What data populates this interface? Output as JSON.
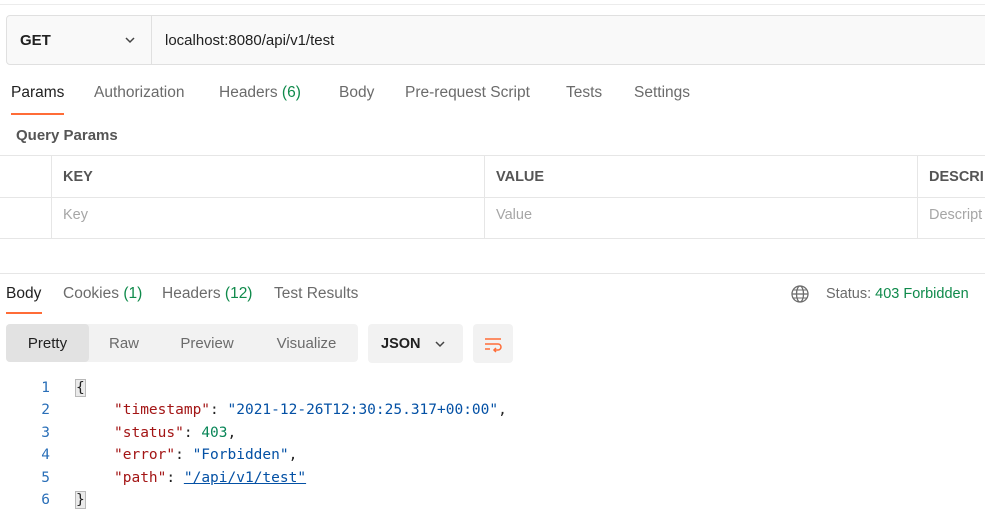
{
  "request": {
    "method": "GET",
    "url": "localhost:8080/api/v1/test"
  },
  "request_tabs": [
    {
      "label": "Params",
      "count": "",
      "active": true
    },
    {
      "label": "Authorization",
      "count": ""
    },
    {
      "label": "Headers",
      "count": "(6)"
    },
    {
      "label": "Body",
      "count": ""
    },
    {
      "label": "Pre-request Script",
      "count": ""
    },
    {
      "label": "Tests",
      "count": ""
    },
    {
      "label": "Settings",
      "count": ""
    }
  ],
  "query_params": {
    "title": "Query Params",
    "columns": [
      "KEY",
      "VALUE",
      "DESCRI"
    ],
    "placeholders": [
      "Key",
      "Value",
      "Descript"
    ]
  },
  "response_tabs": [
    {
      "label": "Body",
      "count": "",
      "active": true
    },
    {
      "label": "Cookies",
      "count": "(1)"
    },
    {
      "label": "Headers",
      "count": "(12)"
    },
    {
      "label": "Test Results",
      "count": ""
    }
  ],
  "status": {
    "label": "Status:",
    "value": "403 Forbidden",
    "icon": "globe-icon",
    "color": "#0f8a4b"
  },
  "view_modes": [
    "Pretty",
    "Raw",
    "Preview",
    "Visualize"
  ],
  "active_view": "Pretty",
  "format": "JSON",
  "accent_color": "#ff6c37",
  "code": {
    "line_numbers": [
      "1",
      "2",
      "3",
      "4",
      "5",
      "6"
    ],
    "open_brace": "{",
    "close_brace": "}",
    "entries": [
      {
        "key": "\"timestamp\"",
        "value": "\"2021-12-26T12:30:25.317+00:00\"",
        "sep": ","
      },
      {
        "key": "\"status\"",
        "value": "403",
        "sep": ","
      },
      {
        "key": "\"error\"",
        "value": "\"Forbidden\"",
        "sep": ","
      },
      {
        "key": "\"path\"",
        "value": "\"/api/v1/test\"",
        "sep": ""
      }
    ]
  }
}
